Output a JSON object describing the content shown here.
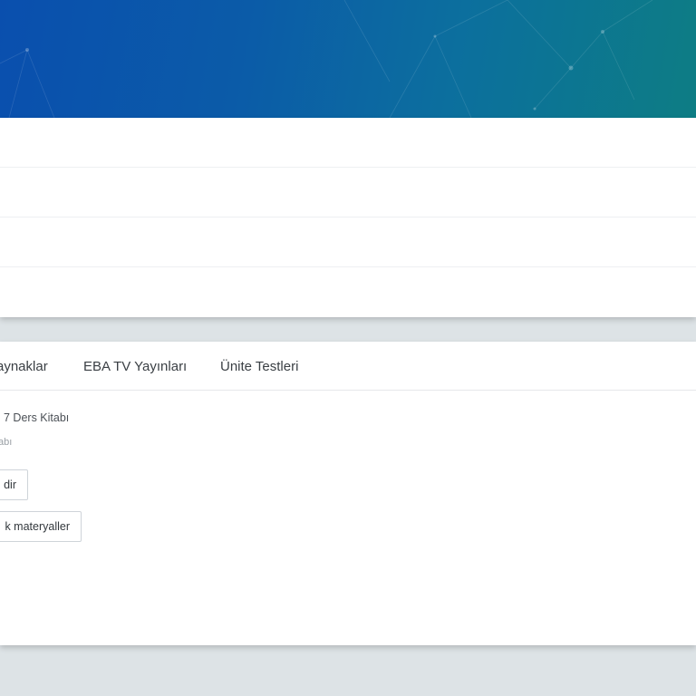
{
  "tabs": [
    {
      "label": "aynaklar"
    },
    {
      "label": "EBA TV Yayınları"
    },
    {
      "label": "Ünite Testleri"
    }
  ],
  "content": {
    "title": "7 Ders Kitabı",
    "subtitle": "abı",
    "download_label": "dir",
    "materials_label": "k materyaller"
  },
  "colors": {
    "hero_start": "#0a4fae",
    "hero_end": "#0d7d84",
    "page_bg": "#dde3e6"
  }
}
